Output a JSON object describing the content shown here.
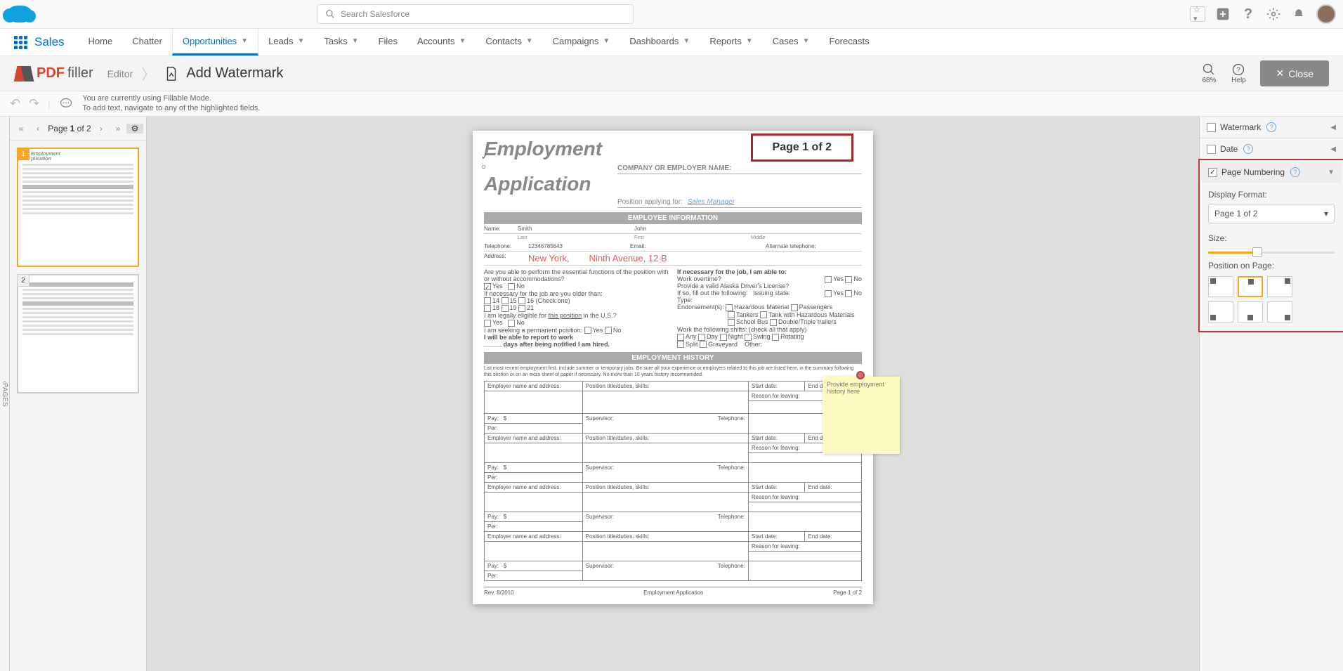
{
  "salesforce": {
    "search_placeholder": "Search Salesforce",
    "app_name": "Sales",
    "tabs": [
      "Home",
      "Chatter",
      "Opportunities",
      "Leads",
      "Tasks",
      "Files",
      "Accounts",
      "Contacts",
      "Campaigns",
      "Dashboards",
      "Reports",
      "Cases",
      "Forecasts"
    ],
    "active_tab_index": 2
  },
  "pdffiller": {
    "brand_pdf": "PDF",
    "brand_filler": "filler",
    "crumb_editor": "Editor",
    "crumb_action": "Add Watermark",
    "zoom_pct": "68%",
    "help_label": "Help",
    "close_label": "Close"
  },
  "info": {
    "line1": "You are currently using Fillable Mode.",
    "line2": "To add text, navigate to any of the highlighted fields."
  },
  "pages": {
    "label_pre": "Page ",
    "current": "1",
    "label_mid": " of ",
    "total": "2",
    "collapse_label": "PAGES"
  },
  "doc": {
    "page_number_display": "Page 1 of 2",
    "title1": "Employment",
    "title2": "Application",
    "company_label": "COMPANY OR EMPLOYER NAME:",
    "position_label": "Position applying for:",
    "position_value": "Sales Manager",
    "sec_employee": "EMPLOYEE INFORMATION",
    "name_label": "Name:",
    "name_last": "Smith",
    "name_first": "John",
    "last": "Last",
    "first": "First",
    "middle": "Middle",
    "tel_label": "Telephone:",
    "tel_val": "12346785643",
    "email_label": "Email:",
    "alt_tel": "Alternate telephone:",
    "addr_label": "Address:",
    "addr_city": "New York,",
    "addr_street": "Ninth Avenue, 12 B",
    "q_essential": "Are you able to perform the essential functions of the position with or without accommodations?",
    "yes": "Yes",
    "no": "No",
    "q_older": "If necessary for the job are you older than:",
    "ages": [
      "14",
      "15",
      "16",
      "(Check one)",
      "18",
      "19",
      "21"
    ],
    "q_legal": "I am legally eligible for ",
    "this_pos": "this position",
    " q_legal2": " in the U.S.?",
    "q_perm": "I am seeking a permanent position:",
    "q_report": "I will be able to report to work",
    "q_report2": "_____ days after being notified I am hired.",
    "r_nec": "If necessary for the job, I am able to:",
    "r_ot": "Work overtime?",
    "r_lic": "Provide a valid Alaska Driver's License?",
    "r_fill": "If so, fill out the following:",
    "r_state": "Issuing state:",
    "r_type": "Type:",
    "r_endorse": "Endorsement(s):",
    "endorse_opts": [
      "Hazardous Material",
      "Passengers",
      "Tankers",
      "Tank with Hazardous Materials",
      "School Bus",
      "Double/Triple trailers"
    ],
    "r_shifts": "Work the following shifts: (check all that apply)",
    "shifts": [
      "Any",
      "Day",
      "Night",
      "Swing",
      "Rotating",
      "Split",
      "Graveyard",
      "Other:"
    ],
    "sec_history": "EMPLOYMENT HISTORY",
    "hist_note": "List most recent employment first. Include summer or temporary jobs. Be sure all your experience or employers related to this job are listed here, in the summary following this section or on an extra sheet of paper if necessary. No more than 10 years history recommended.",
    "col_emp": "Employer name and address:",
    "col_pos": "Position title/duties, skills:",
    "col_start": "Start date:",
    "col_end": "End date:",
    "col_reason": "Reason for leaving:",
    "col_pay": "Pay:",
    "col_per": "Per:",
    "col_sup": "Supervisor:",
    "col_tel": "Telephone:",
    "dollar": "$",
    "foot_rev": "Rev. 8/2010",
    "foot_title": "Employment Application",
    "foot_page": "Page 1 of 2",
    "sticky": "Provide employment history here"
  },
  "right": {
    "watermark": "Watermark",
    "date": "Date",
    "page_numbering": "Page Numbering",
    "display_format_label": "Display Format:",
    "display_format_value": "Page 1 of 2",
    "size_label": "Size:",
    "position_label": "Position on Page:"
  }
}
